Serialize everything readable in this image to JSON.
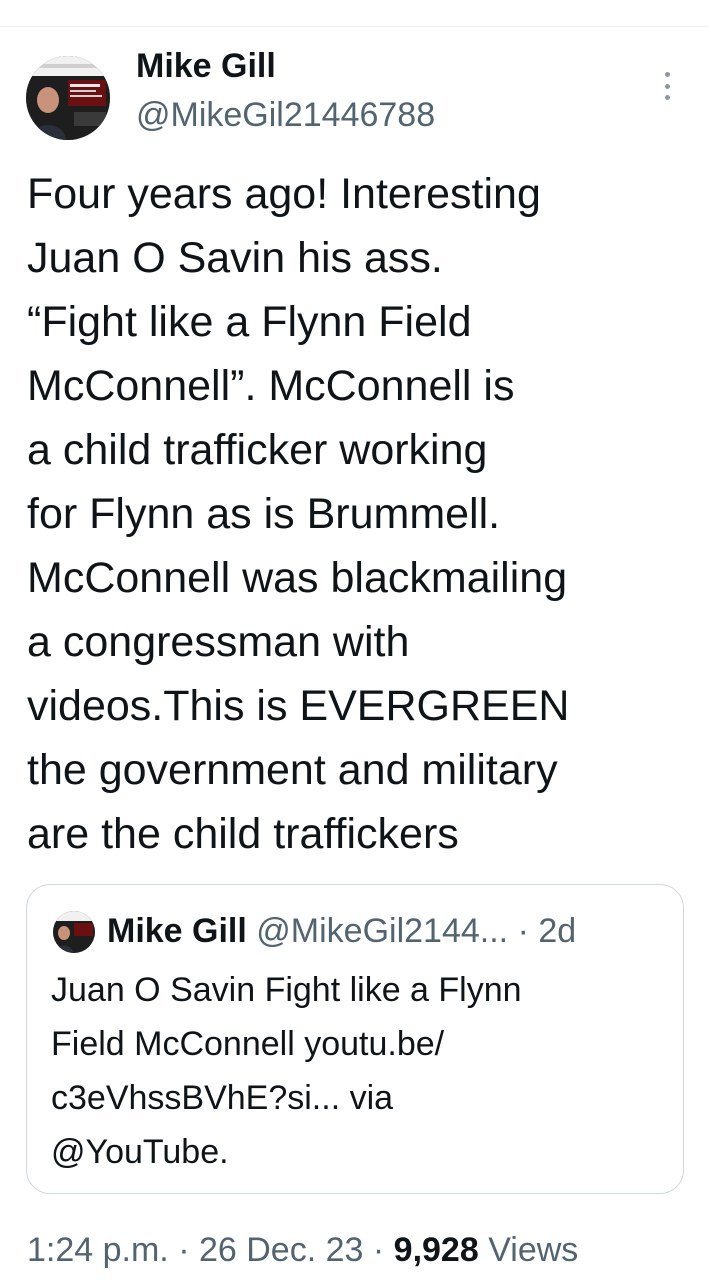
{
  "author": {
    "name": "Mike Gill",
    "handle": "@MikeGil21446788"
  },
  "tweet": {
    "lines": [
      "Four years ago!  Interesting",
      "Juan O Savin his ass.",
      "“Fight like a Flynn Field",
      "McConnell”. McConnell is",
      "a child trafficker working",
      "for Flynn as is Brummell.",
      "McConnell was blackmailing",
      "a congressman with",
      "videos.This is EVERGREEN",
      "the government and military",
      "are the child traffickers"
    ]
  },
  "quoted_tweet": {
    "name": "Mike Gill",
    "handle_truncated": "@MikeGil2144...",
    "separator": "·",
    "age": "2d",
    "lines": [
      "Juan O Savin Fight like a Flynn",
      "Field McConnell youtu.be/",
      "c3eVhssBVhE?si... via",
      "@YouTube."
    ]
  },
  "meta": {
    "time": "1:24 p.m.",
    "separator": "·",
    "date": "26 Dec. 23",
    "views_count": "9,928",
    "views_label": "Views"
  },
  "icons": {
    "more": "more-vertical-icon"
  },
  "colors": {
    "text_primary": "#0f1419",
    "text_secondary": "#536471",
    "border": "#cfd9de"
  }
}
